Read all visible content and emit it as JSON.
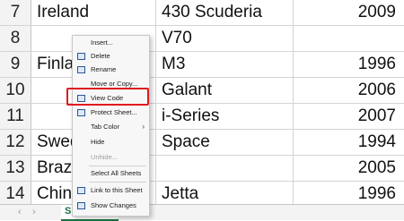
{
  "rows": [
    {
      "num": "7",
      "a": "Ireland",
      "b": "430 Scuderia",
      "c": "2009"
    },
    {
      "num": "8",
      "a": "",
      "b": "V70",
      "c": ""
    },
    {
      "num": "9",
      "a": "Finla",
      "b": "M3",
      "c": "1996"
    },
    {
      "num": "10",
      "a": "",
      "b": "Galant",
      "c": "2006"
    },
    {
      "num": "11",
      "a": "",
      "b": "i-Series",
      "c": "2007"
    },
    {
      "num": "12",
      "a": "Swed",
      "b": "Space",
      "c": "1994"
    },
    {
      "num": "13",
      "a": "Braz",
      "b": "",
      "c": "2005"
    },
    {
      "num": "14",
      "a": "Chin",
      "b": "Jetta",
      "c": "1996"
    }
  ],
  "tabs": {
    "prev": "‹",
    "next": "›",
    "active": "Sh"
  },
  "context_menu": {
    "insert": "Insert...",
    "delete": "Delete",
    "rename": "Rename",
    "move_copy": "Move or Copy...",
    "view_code": "View Code",
    "protect_sheet": "Protect Sheet...",
    "tab_color": "Tab Color",
    "hide": "Hide",
    "unhide": "Unhide...",
    "select_all_sheets": "Select All Sheets",
    "link_to_sheet": "Link to this Sheet",
    "show_changes": "Show Changes"
  },
  "icons": {
    "delete": "delete-sheet-icon",
    "rename": "rename-sheet-icon",
    "view_code": "view-code-icon",
    "protect": "protect-sheet-icon",
    "link": "link-icon",
    "show_changes": "show-changes-icon",
    "submenu": "chevron-right-icon"
  },
  "colors": {
    "highlight": "#e0191e",
    "sheet_tab": "#1e7145"
  }
}
